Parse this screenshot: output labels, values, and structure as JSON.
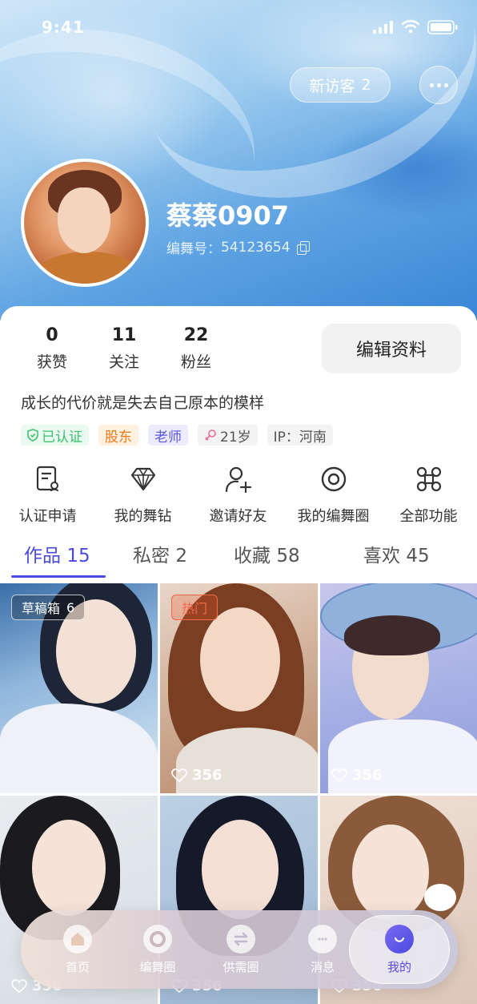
{
  "status": {
    "time": "9:41"
  },
  "header": {
    "visitor_label": "新访客",
    "visitor_count": "2",
    "username": "蔡蔡0907",
    "id_label": "编舞号：",
    "id_value": "54123654"
  },
  "stats": [
    {
      "num": "0",
      "label": "获赞"
    },
    {
      "num": "11",
      "label": "关注"
    },
    {
      "num": "22",
      "label": "粉丝"
    }
  ],
  "edit_label": "编辑资料",
  "bio": "成长的代价就是失去自己原本的模样",
  "tags": {
    "verified": "已认证",
    "shareholder": "股东",
    "teacher": "老师",
    "age": "21岁",
    "ip": "IP：河南"
  },
  "functions": [
    {
      "label": "认证申请",
      "icon": "certificate-icon"
    },
    {
      "label": "我的舞钻",
      "icon": "diamond-icon"
    },
    {
      "label": "邀请好友",
      "icon": "add-user-icon"
    },
    {
      "label": "我的编舞圈",
      "icon": "circle-target-icon"
    },
    {
      "label": "全部功能",
      "icon": "grid-command-icon"
    }
  ],
  "tabs": [
    {
      "label": "作品",
      "count": "15"
    },
    {
      "label": "私密",
      "count": "2"
    },
    {
      "label": "收藏",
      "count": "58"
    },
    {
      "label": "喜欢",
      "count": "45"
    }
  ],
  "grid": {
    "draft_label": "草稿箱",
    "draft_count": "6",
    "hot_label": "热门",
    "likes": [
      "356",
      "356"
    ],
    "likes_row2": [
      "356",
      "356",
      "356"
    ]
  },
  "tabbar": [
    {
      "label": "首页",
      "icon": "home-icon"
    },
    {
      "label": "编舞圈",
      "icon": "ring-icon"
    },
    {
      "label": "供需圈",
      "icon": "swap-icon"
    },
    {
      "label": "消息",
      "icon": "chat-icon"
    },
    {
      "label": "我的",
      "icon": "smile-icon"
    }
  ],
  "colors": {
    "accent": "#4a4ae0",
    "hot": "#f06a4a",
    "verified": "#3cbf6a",
    "shareholder": "#f07a1a"
  }
}
